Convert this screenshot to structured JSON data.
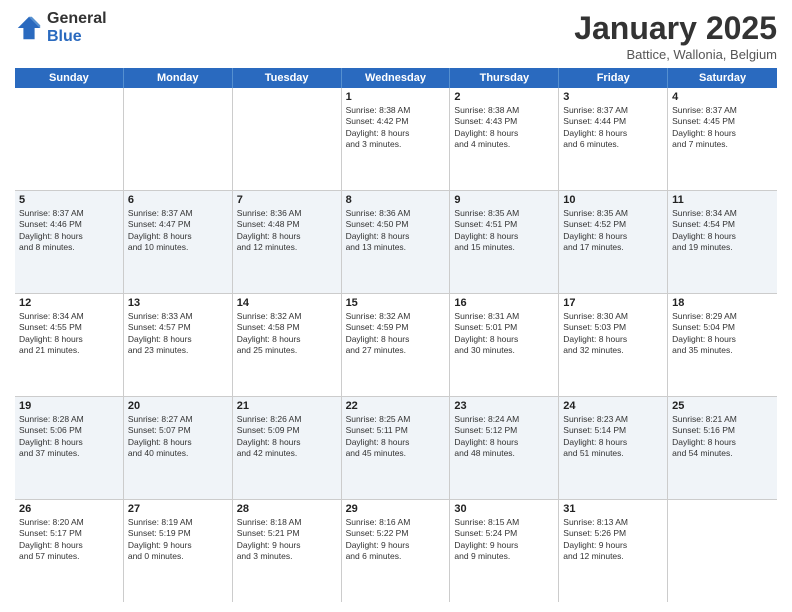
{
  "logo": {
    "general": "General",
    "blue": "Blue"
  },
  "header": {
    "month": "January 2025",
    "location": "Battice, Wallonia, Belgium"
  },
  "days": [
    "Sunday",
    "Monday",
    "Tuesday",
    "Wednesday",
    "Thursday",
    "Friday",
    "Saturday"
  ],
  "rows": [
    [
      {
        "day": "",
        "info": ""
      },
      {
        "day": "",
        "info": ""
      },
      {
        "day": "",
        "info": ""
      },
      {
        "day": "1",
        "info": "Sunrise: 8:38 AM\nSunset: 4:42 PM\nDaylight: 8 hours\nand 3 minutes."
      },
      {
        "day": "2",
        "info": "Sunrise: 8:38 AM\nSunset: 4:43 PM\nDaylight: 8 hours\nand 4 minutes."
      },
      {
        "day": "3",
        "info": "Sunrise: 8:37 AM\nSunset: 4:44 PM\nDaylight: 8 hours\nand 6 minutes."
      },
      {
        "day": "4",
        "info": "Sunrise: 8:37 AM\nSunset: 4:45 PM\nDaylight: 8 hours\nand 7 minutes."
      }
    ],
    [
      {
        "day": "5",
        "info": "Sunrise: 8:37 AM\nSunset: 4:46 PM\nDaylight: 8 hours\nand 8 minutes."
      },
      {
        "day": "6",
        "info": "Sunrise: 8:37 AM\nSunset: 4:47 PM\nDaylight: 8 hours\nand 10 minutes."
      },
      {
        "day": "7",
        "info": "Sunrise: 8:36 AM\nSunset: 4:48 PM\nDaylight: 8 hours\nand 12 minutes."
      },
      {
        "day": "8",
        "info": "Sunrise: 8:36 AM\nSunset: 4:50 PM\nDaylight: 8 hours\nand 13 minutes."
      },
      {
        "day": "9",
        "info": "Sunrise: 8:35 AM\nSunset: 4:51 PM\nDaylight: 8 hours\nand 15 minutes."
      },
      {
        "day": "10",
        "info": "Sunrise: 8:35 AM\nSunset: 4:52 PM\nDaylight: 8 hours\nand 17 minutes."
      },
      {
        "day": "11",
        "info": "Sunrise: 8:34 AM\nSunset: 4:54 PM\nDaylight: 8 hours\nand 19 minutes."
      }
    ],
    [
      {
        "day": "12",
        "info": "Sunrise: 8:34 AM\nSunset: 4:55 PM\nDaylight: 8 hours\nand 21 minutes."
      },
      {
        "day": "13",
        "info": "Sunrise: 8:33 AM\nSunset: 4:57 PM\nDaylight: 8 hours\nand 23 minutes."
      },
      {
        "day": "14",
        "info": "Sunrise: 8:32 AM\nSunset: 4:58 PM\nDaylight: 8 hours\nand 25 minutes."
      },
      {
        "day": "15",
        "info": "Sunrise: 8:32 AM\nSunset: 4:59 PM\nDaylight: 8 hours\nand 27 minutes."
      },
      {
        "day": "16",
        "info": "Sunrise: 8:31 AM\nSunset: 5:01 PM\nDaylight: 8 hours\nand 30 minutes."
      },
      {
        "day": "17",
        "info": "Sunrise: 8:30 AM\nSunset: 5:03 PM\nDaylight: 8 hours\nand 32 minutes."
      },
      {
        "day": "18",
        "info": "Sunrise: 8:29 AM\nSunset: 5:04 PM\nDaylight: 8 hours\nand 35 minutes."
      }
    ],
    [
      {
        "day": "19",
        "info": "Sunrise: 8:28 AM\nSunset: 5:06 PM\nDaylight: 8 hours\nand 37 minutes."
      },
      {
        "day": "20",
        "info": "Sunrise: 8:27 AM\nSunset: 5:07 PM\nDaylight: 8 hours\nand 40 minutes."
      },
      {
        "day": "21",
        "info": "Sunrise: 8:26 AM\nSunset: 5:09 PM\nDaylight: 8 hours\nand 42 minutes."
      },
      {
        "day": "22",
        "info": "Sunrise: 8:25 AM\nSunset: 5:11 PM\nDaylight: 8 hours\nand 45 minutes."
      },
      {
        "day": "23",
        "info": "Sunrise: 8:24 AM\nSunset: 5:12 PM\nDaylight: 8 hours\nand 48 minutes."
      },
      {
        "day": "24",
        "info": "Sunrise: 8:23 AM\nSunset: 5:14 PM\nDaylight: 8 hours\nand 51 minutes."
      },
      {
        "day": "25",
        "info": "Sunrise: 8:21 AM\nSunset: 5:16 PM\nDaylight: 8 hours\nand 54 minutes."
      }
    ],
    [
      {
        "day": "26",
        "info": "Sunrise: 8:20 AM\nSunset: 5:17 PM\nDaylight: 8 hours\nand 57 minutes."
      },
      {
        "day": "27",
        "info": "Sunrise: 8:19 AM\nSunset: 5:19 PM\nDaylight: 9 hours\nand 0 minutes."
      },
      {
        "day": "28",
        "info": "Sunrise: 8:18 AM\nSunset: 5:21 PM\nDaylight: 9 hours\nand 3 minutes."
      },
      {
        "day": "29",
        "info": "Sunrise: 8:16 AM\nSunset: 5:22 PM\nDaylight: 9 hours\nand 6 minutes."
      },
      {
        "day": "30",
        "info": "Sunrise: 8:15 AM\nSunset: 5:24 PM\nDaylight: 9 hours\nand 9 minutes."
      },
      {
        "day": "31",
        "info": "Sunrise: 8:13 AM\nSunset: 5:26 PM\nDaylight: 9 hours\nand 12 minutes."
      },
      {
        "day": "",
        "info": ""
      }
    ]
  ]
}
